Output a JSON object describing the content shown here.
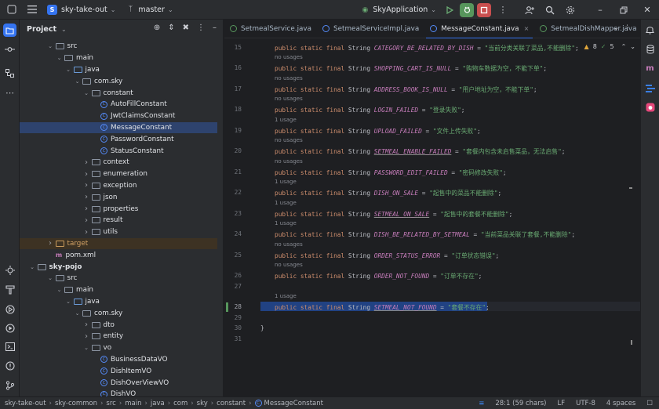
{
  "titlebar": {
    "project_badge": "S",
    "project_name": "sky-take-out",
    "branch": "master",
    "run_config": "SkyApplication"
  },
  "project_panel": {
    "title": "Project",
    "tree": [
      {
        "label": "src",
        "indent": 3,
        "type": "folder",
        "expanded": true
      },
      {
        "label": "main",
        "indent": 4,
        "type": "folder",
        "expanded": true
      },
      {
        "label": "java",
        "indent": 5,
        "type": "folder-blue",
        "expanded": true
      },
      {
        "label": "com.sky",
        "indent": 6,
        "type": "package",
        "expanded": true
      },
      {
        "label": "constant",
        "indent": 7,
        "type": "package",
        "expanded": true
      },
      {
        "label": "AutoFillConstant",
        "indent": 8,
        "type": "class"
      },
      {
        "label": "JwtClaimsConstant",
        "indent": 8,
        "type": "class"
      },
      {
        "label": "MessageConstant",
        "indent": 8,
        "type": "class",
        "selected": true
      },
      {
        "label": "PasswordConstant",
        "indent": 8,
        "type": "class"
      },
      {
        "label": "StatusConstant",
        "indent": 8,
        "type": "class"
      },
      {
        "label": "context",
        "indent": 7,
        "type": "package",
        "expanded": false
      },
      {
        "label": "enumeration",
        "indent": 7,
        "type": "package",
        "expanded": false
      },
      {
        "label": "exception",
        "indent": 7,
        "type": "package",
        "expanded": false
      },
      {
        "label": "json",
        "indent": 7,
        "type": "package",
        "expanded": false
      },
      {
        "label": "properties",
        "indent": 7,
        "type": "package",
        "expanded": false
      },
      {
        "label": "result",
        "indent": 7,
        "type": "package",
        "expanded": false
      },
      {
        "label": "utils",
        "indent": 7,
        "type": "package",
        "expanded": false
      },
      {
        "label": "target",
        "indent": 3,
        "type": "folder-orange",
        "expanded": false,
        "target": true
      },
      {
        "label": "pom.xml",
        "indent": 3,
        "type": "maven"
      },
      {
        "label": "sky-pojo",
        "indent": 1,
        "type": "folder",
        "expanded": true,
        "bold": true
      },
      {
        "label": "src",
        "indent": 3,
        "type": "folder",
        "expanded": true
      },
      {
        "label": "main",
        "indent": 4,
        "type": "folder",
        "expanded": true
      },
      {
        "label": "java",
        "indent": 5,
        "type": "folder-blue",
        "expanded": true
      },
      {
        "label": "com.sky",
        "indent": 6,
        "type": "package",
        "expanded": true
      },
      {
        "label": "dto",
        "indent": 7,
        "type": "package",
        "expanded": false
      },
      {
        "label": "entity",
        "indent": 7,
        "type": "package",
        "expanded": false
      },
      {
        "label": "vo",
        "indent": 7,
        "type": "package",
        "expanded": true
      },
      {
        "label": "BusinessDataVO",
        "indent": 8,
        "type": "class"
      },
      {
        "label": "DishItemVO",
        "indent": 8,
        "type": "class"
      },
      {
        "label": "DishOverViewVO",
        "indent": 8,
        "type": "class"
      },
      {
        "label": "DishVO",
        "indent": 8,
        "type": "class"
      }
    ]
  },
  "tabs": [
    {
      "label": "SetmealService.java",
      "icon": "interface-icon"
    },
    {
      "label": "SetmealServiceImpl.java",
      "icon": "class-icon"
    },
    {
      "label": "MessageConstant.java",
      "icon": "class-icon",
      "active": true,
      "close": "×"
    },
    {
      "label": "SetmealDishMapper.java",
      "icon": "interface-icon"
    }
  ],
  "inspections": {
    "warnings": "8",
    "ok": "5"
  },
  "code": [
    {
      "ln": "15",
      "hint": "",
      "name": "CATEGORY_BE_RELATED_BY_DISH",
      "value": "\"当前分类关联了菜品,不能删除\"",
      "underline": false
    },
    {
      "ln": "16",
      "hint": "no usages",
      "name": "SHOPPING_CART_IS_NULL",
      "value": "\"购物车数据为空，不能下单\"",
      "underline": false
    },
    {
      "ln": "17",
      "hint": "no usages",
      "name": "ADDRESS_BOOK_IS_NULL",
      "value": "\"用户地址为空，不能下单\"",
      "underline": false
    },
    {
      "ln": "18",
      "hint": "no usages",
      "name": "LOGIN_FAILED",
      "value": "\"登录失败\"",
      "underline": false
    },
    {
      "ln": "19",
      "hint": "1 usage",
      "name": "UPLOAD_FAILED",
      "value": "\"文件上传失败\"",
      "underline": false
    },
    {
      "ln": "20",
      "hint": "no usages",
      "name": "SETMEAL_ENABLE_FAILED",
      "value": "\"套餐内包含未启售菜品，无法启售\"",
      "underline": true
    },
    {
      "ln": "21",
      "hint": "no usages",
      "name": "PASSWORD_EDIT_FAILED",
      "value": "\"密码修改失败\"",
      "underline": false
    },
    {
      "ln": "22",
      "hint": "1 usage",
      "name": "DISH_ON_SALE",
      "value": "\"起售中的菜品不能删除\"",
      "underline": false
    },
    {
      "ln": "23",
      "hint": "1 usage",
      "name": "SETMEAL_ON_SALE",
      "value": "\"起售中的套餐不能删除\"",
      "underline": true
    },
    {
      "ln": "24",
      "hint": "1 usage",
      "name": "DISH_BE_RELATED_BY_SETMEAL",
      "value": "\"当前菜品关联了套餐,不能删除\"",
      "underline": false
    },
    {
      "ln": "25",
      "hint": "no usages",
      "name": "ORDER_STATUS_ERROR",
      "value": "\"订单状态错误\"",
      "underline": false
    },
    {
      "ln": "26",
      "hint": "no usages",
      "name": "ORDER_NOT_FOUND",
      "value": "\"订单不存在\"",
      "underline": false
    },
    {
      "ln": "27",
      "hint": "",
      "name": "",
      "value": "",
      "underline": false
    },
    {
      "ln": "28",
      "hint": "1 usage",
      "name": "SETMEAL_NOT_FOUND",
      "value": "\"套餐不存在\"",
      "underline": true,
      "current": true
    },
    {
      "ln": "29",
      "hint": "",
      "name": "",
      "value": "",
      "underline": false
    },
    {
      "ln": "30",
      "hint": "",
      "name": "}",
      "value": "",
      "underline": false,
      "brace": true
    },
    {
      "ln": "31",
      "hint": "",
      "name": "",
      "value": "",
      "underline": false
    }
  ],
  "code_prefix": "public static final String ",
  "status": {
    "breadcrumbs": [
      "sky-take-out",
      "sky-common",
      "src",
      "main",
      "java",
      "com",
      "sky",
      "constant",
      "MessageConstant"
    ],
    "position": "28:1 (59 chars)",
    "line_sep": "LF",
    "encoding": "UTF-8",
    "indent": "4 spaces"
  }
}
